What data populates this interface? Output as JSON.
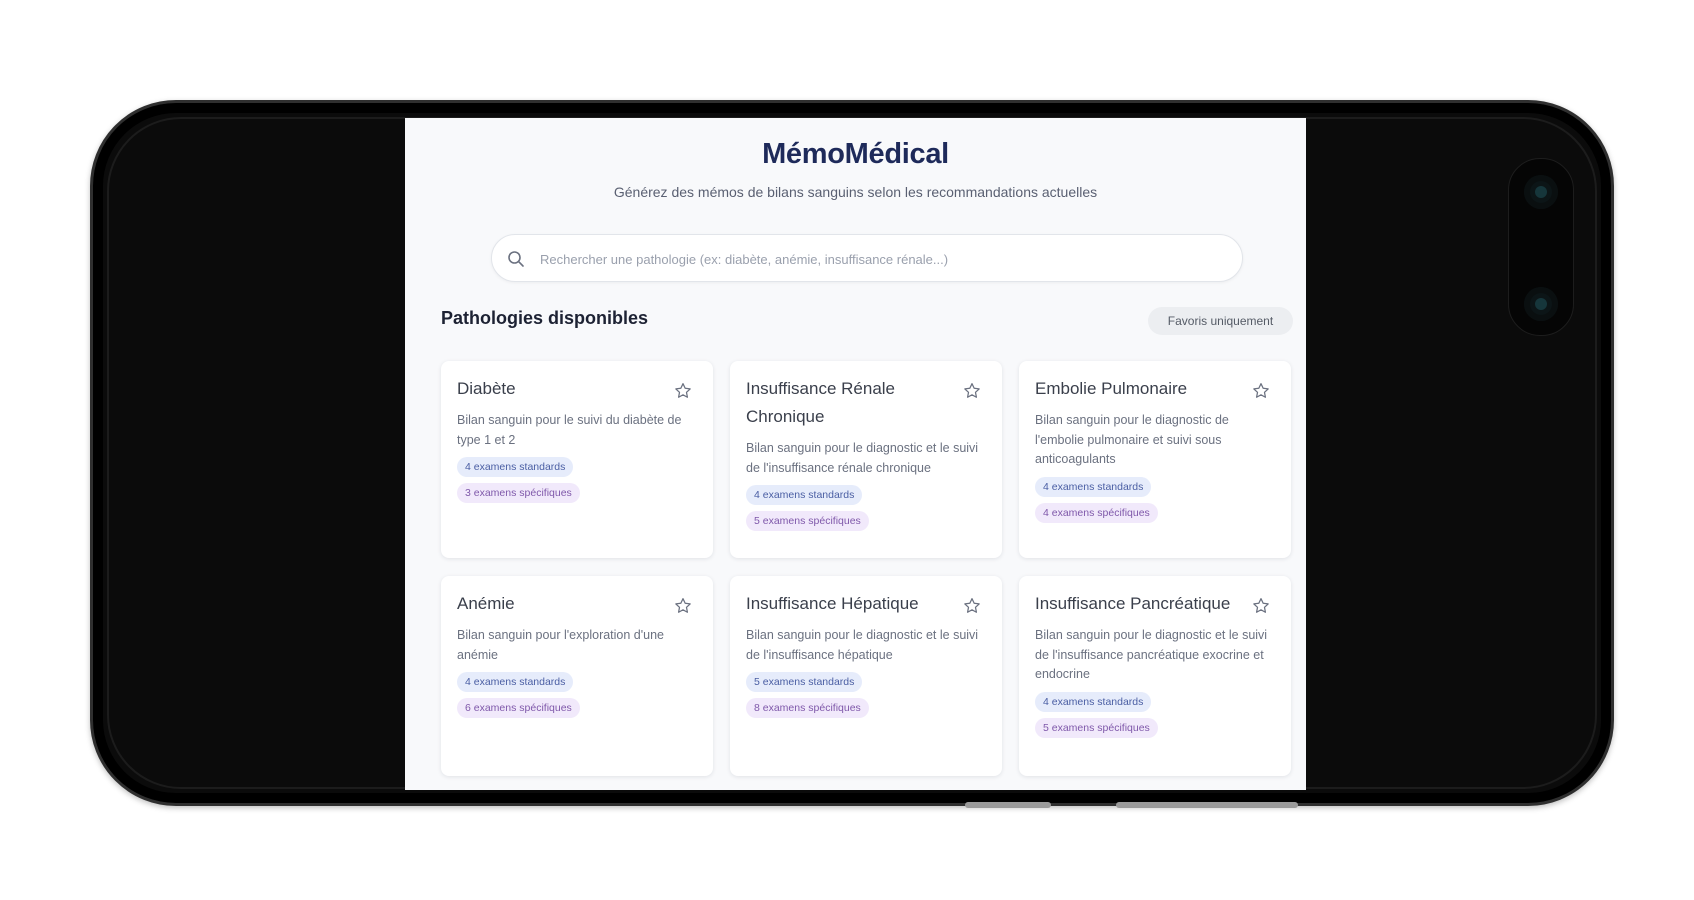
{
  "app": {
    "title": "MémoMédical",
    "subtitle": "Générez des mémos de bilans sanguins selon les recommandations actuelles"
  },
  "search": {
    "placeholder": "Rechercher une pathologie (ex: diabète, anémie, insuffisance rénale...)",
    "value": ""
  },
  "section": {
    "title": "Pathologies disponibles",
    "favorites_toggle": "Favoris uniquement"
  },
  "pathologies": [
    {
      "name": "Diabète",
      "description": "Bilan sanguin pour le suivi du diabète de type 1 et 2",
      "standard": "4 examens standards",
      "specific": "3 examens spécifiques"
    },
    {
      "name": "Insuffisance Rénale Chronique",
      "description": "Bilan sanguin pour le diagnostic et le suivi de l'insuffisance rénale chronique",
      "standard": "4 examens standards",
      "specific": "5 examens spécifiques"
    },
    {
      "name": "Embolie Pulmonaire",
      "description": "Bilan sanguin pour le diagnostic de l'embolie pulmonaire et suivi sous anticoagulants",
      "standard": "4 examens standards",
      "specific": "4 examens spécifiques"
    },
    {
      "name": "Anémie",
      "description": "Bilan sanguin pour l'exploration d'une anémie",
      "standard": "4 examens standards",
      "specific": "6 examens spécifiques"
    },
    {
      "name": "Insuffisance Hépatique",
      "description": "Bilan sanguin pour le diagnostic et le suivi de l'insuffisance hépatique",
      "standard": "5 examens standards",
      "specific": "8 examens spécifiques"
    },
    {
      "name": "Insuffisance Pancréatique",
      "description": "Bilan sanguin pour le diagnostic et le suivi de l'insuffisance pancréatique exocrine et endocrine",
      "standard": "4 examens standards",
      "specific": "5 examens spécifiques"
    }
  ],
  "colors": {
    "title": "#1e2a5a",
    "badge_standard_bg": "#e6ecfb",
    "badge_specific_bg": "#f1e9fb"
  }
}
